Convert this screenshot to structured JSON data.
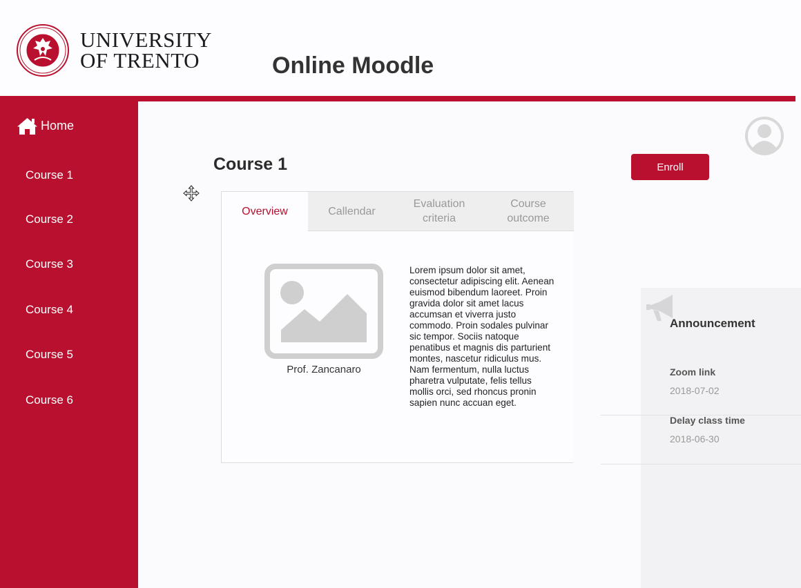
{
  "header": {
    "logo_line1": "UNIVERSITY",
    "logo_line2": "OF TRENTO",
    "title": "Online Moodle"
  },
  "sidebar": {
    "home_label": "Home",
    "items": [
      {
        "label": "Course 1"
      },
      {
        "label": "Course 2"
      },
      {
        "label": "Course 3"
      },
      {
        "label": "Course 4"
      },
      {
        "label": "Course 5"
      },
      {
        "label": "Course 6"
      }
    ]
  },
  "main": {
    "title": "Course 1",
    "enroll_label": "Enroll",
    "tabs": [
      {
        "label": "Overview",
        "active": true
      },
      {
        "label": "Callendar",
        "active": false
      },
      {
        "label": "Evaluation criteria",
        "active": false
      },
      {
        "label": "Course outcome",
        "active": false
      }
    ],
    "professor": "Prof. Zancanaro",
    "description": "Lorem ipsum dolor sit amet, consectetur adipiscing elit. Aenean euismod bibendum laoreet. Proin gravida dolor sit amet lacus accumsan et viverra justo commodo. Proin sodales pulvinar sic tempor. Sociis natoque penatibus et magnis dis parturient montes, nascetur ridiculus mus. Nam fermentum, nulla luctus pharetra vulputate, felis tellus mollis orci, sed rhoncus pronin sapien nunc accuan eget."
  },
  "announcements": {
    "title": "Announcement",
    "items": [
      {
        "title": "Zoom link",
        "date": "2018-07-02"
      },
      {
        "title": "Delay class time",
        "date": "2018-06-30"
      }
    ]
  },
  "colors": {
    "accent": "#b8102e",
    "tab_inactive_bg": "#eeeeef",
    "panel_bg": "#f2f2f4"
  },
  "icons": {
    "home": "home-icon",
    "avatar": "user-avatar-icon",
    "image": "image-placeholder-icon",
    "megaphone": "megaphone-icon",
    "cursor": "move-cursor-icon",
    "seal": "university-seal-logo"
  }
}
